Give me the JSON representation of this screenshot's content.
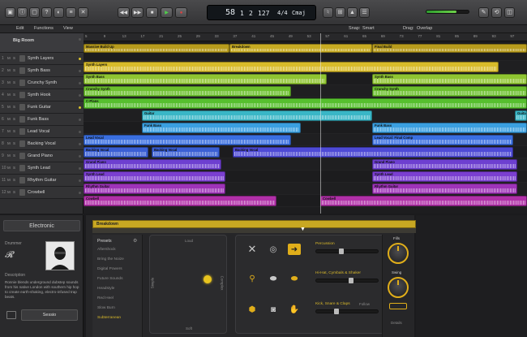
{
  "colors": {
    "master": "#b79b1c",
    "yellow": "#d8bb2a",
    "lime": "#8fc531",
    "green": "#56bf2e",
    "cyan": "#39b6c6",
    "lightblue": "#3a9fe0",
    "blue": "#3a5fd4",
    "purple": "#7b3fd0",
    "magenta": "#9e33b8",
    "accent": "#e0ae1a"
  },
  "toolbar": {
    "icons": [
      {
        "name": "library-icon",
        "glyph": "▣"
      },
      {
        "name": "inspector-icon",
        "glyph": "ⓘ"
      },
      {
        "name": "toolbar-icon",
        "glyph": "▢"
      },
      {
        "name": "help-icon",
        "glyph": "?"
      },
      {
        "name": "smart-controls-icon",
        "glyph": "◐"
      },
      {
        "name": "mixer-icon",
        "glyph": "≡"
      },
      {
        "name": "editors-icon",
        "glyph": "✕"
      }
    ],
    "transport": [
      {
        "name": "rewind-icon",
        "glyph": "◀◀"
      },
      {
        "name": "forward-icon",
        "glyph": "▶▶"
      },
      {
        "name": "stop-icon",
        "glyph": "■"
      },
      {
        "name": "play-icon",
        "glyph": "▶"
      },
      {
        "name": "record-icon",
        "glyph": "●"
      }
    ],
    "lcd": {
      "bar": "58",
      "beat": "1",
      "div": "2",
      "bpm": "127",
      "sig": "4/4",
      "key": "Cmaj"
    },
    "right_icons": [
      {
        "name": "tuner-icon",
        "glyph": "♮"
      },
      {
        "name": "count-in-icon",
        "glyph": "⊞"
      },
      {
        "name": "metronome-icon",
        "glyph": "▲"
      },
      {
        "name": "list-editor-icon",
        "glyph": "☰"
      },
      {
        "name": "notepad-icon",
        "glyph": "✎"
      },
      {
        "name": "loop-browser-icon",
        "glyph": "⟲"
      },
      {
        "name": "browser-icon",
        "glyph": "◫"
      }
    ],
    "master_volume": 0.72
  },
  "menubar": {
    "items": [
      "Edit",
      "Functions",
      "View"
    ],
    "right_items": [
      "Snap:",
      "Smart",
      "Drag:",
      "Overlap"
    ]
  },
  "ruler": {
    "ticks": [
      "5",
      "9",
      "13",
      "17",
      "21",
      "25",
      "29",
      "33",
      "37",
      "41",
      "45",
      "49",
      "53",
      "57",
      "61",
      "65",
      "69",
      "73",
      "77",
      "81",
      "85",
      "89",
      "93",
      "97"
    ]
  },
  "tracks": [
    {
      "num": "",
      "name": "Big Room",
      "master": true
    },
    {
      "num": "1",
      "name": "Synth Layers",
      "led": true
    },
    {
      "num": "2",
      "name": "Synth Bass"
    },
    {
      "num": "3",
      "name": "Crunchy Synth"
    },
    {
      "num": "4",
      "name": "Synth Hook"
    },
    {
      "num": "5",
      "name": "Funk Guitar",
      "led": true
    },
    {
      "num": "6",
      "name": "Funk Bass"
    },
    {
      "num": "7",
      "name": "Lead Vocal"
    },
    {
      "num": "8",
      "name": "Backing Vocal"
    },
    {
      "num": "9",
      "name": "Grand Piano"
    },
    {
      "num": "10",
      "name": "Synth Lead"
    },
    {
      "num": "11",
      "name": "Rhythm Guitar"
    },
    {
      "num": "12",
      "name": "Crowbell"
    }
  ],
  "regions": [
    {
      "lane": 0,
      "start": 0,
      "end": 180,
      "label": "Massive Build Up",
      "color": "#b79b1c"
    },
    {
      "lane": 0,
      "start": 180,
      "end": 356,
      "label": "Breakdown",
      "color": "#c7ab22"
    },
    {
      "lane": 0,
      "start": 356,
      "end": 547,
      "label": "Final Build",
      "color": "#b79b1c"
    },
    {
      "lane": 1,
      "start": 0,
      "end": 512,
      "label": "Synth Layers",
      "color": "#d8bb2a"
    },
    {
      "lane": 2,
      "start": 0,
      "end": 300,
      "label": "Synth Bass",
      "color": "#8fc531"
    },
    {
      "lane": 2,
      "start": 356,
      "end": 547,
      "label": "Synth Bass",
      "color": "#8fc531"
    },
    {
      "lane": 3,
      "start": 0,
      "end": 256,
      "label": "Crunchy Synth",
      "color": "#6cc02e"
    },
    {
      "lane": 3,
      "start": 356,
      "end": 547,
      "label": "Crunchy Synth",
      "color": "#6cc02e"
    },
    {
      "lane": 4,
      "start": 0,
      "end": 547,
      "label": "C-Plans",
      "color": "#56bf2e"
    },
    {
      "lane": 5,
      "start": 72,
      "end": 356,
      "label": "Guitar",
      "color": "#39b6c6"
    },
    {
      "lane": 5,
      "start": 532,
      "end": 547,
      "label": "Guitar",
      "color": "#39b6c6"
    },
    {
      "lane": 6,
      "start": 72,
      "end": 268,
      "label": "Funk Bass",
      "color": "#3a9fe0"
    },
    {
      "lane": 6,
      "start": 356,
      "end": 547,
      "label": "Funk Bass",
      "color": "#3a9fe0"
    },
    {
      "lane": 7,
      "start": 0,
      "end": 256,
      "label": "Lead Vocal",
      "color": "#3a6fe0"
    },
    {
      "lane": 7,
      "start": 356,
      "end": 530,
      "label": "Lead Vocal: Final Comp",
      "color": "#3a6fe0"
    },
    {
      "lane": 8,
      "start": 0,
      "end": 80,
      "label": "Backing Vocal",
      "color": "#3a5fd4"
    },
    {
      "lane": 8,
      "start": 84,
      "end": 168,
      "label": "Backing Vocal",
      "color": "#3a5fd4"
    },
    {
      "lane": 8,
      "start": 184,
      "end": 530,
      "label": "Backing Vocal",
      "color": "#4e4ad6"
    },
    {
      "lane": 9,
      "start": 0,
      "end": 170,
      "label": "Grand Piano",
      "color": "#6d3fd0"
    },
    {
      "lane": 9,
      "start": 356,
      "end": 535,
      "label": "Grand Piano",
      "color": "#6d3fd0"
    },
    {
      "lane": 10,
      "start": 0,
      "end": 175,
      "label": "Synth Lead",
      "color": "#7b3fd0"
    },
    {
      "lane": 10,
      "start": 356,
      "end": 535,
      "label": "Synth Lead",
      "color": "#7b3fd0"
    },
    {
      "lane": 11,
      "start": 0,
      "end": 175,
      "label": "Rhythm Guitar",
      "color": "#9e33b8"
    },
    {
      "lane": 11,
      "start": 356,
      "end": 535,
      "label": "Rhythm Guitar",
      "color": "#9e33b8"
    },
    {
      "lane": 12,
      "start": 0,
      "end": 238,
      "label": "Cowbell",
      "color": "#b130a8"
    },
    {
      "lane": 12,
      "start": 292,
      "end": 547,
      "label": "Cowbell",
      "color": "#b130a8"
    }
  ],
  "library": {
    "genre": "Electronic",
    "drummer_label": "Drummer",
    "description_label": "Description",
    "description": "Ronnie blends underground dubstep sounds from his native London with southern hip hop to create earth-shaking, electro-infused trap beats.",
    "button": "Sessio"
  },
  "editor": {
    "region_name": "Breakdown",
    "presets_title": "Presets",
    "presets": [
      "Aftershock",
      "Bring the Noize",
      "Digital Powers",
      "Future Sounds",
      "Headstyle",
      "Red Heel",
      "Slow Burn",
      "Subterranean"
    ],
    "selected_preset": "Subterranean",
    "xy_labels": [
      "Loud",
      "Soft",
      "Simple",
      "Complex"
    ],
    "kit_labels": [
      "Percussion",
      "Hi-Hat, Cymbals & Shaker",
      "Kick, Snare & Claps"
    ],
    "follow_label": "Follow",
    "fills_label": "Fills",
    "swing_label": "Swing",
    "details_label": "Details",
    "fills": 0.78,
    "swing": 0.55
  }
}
